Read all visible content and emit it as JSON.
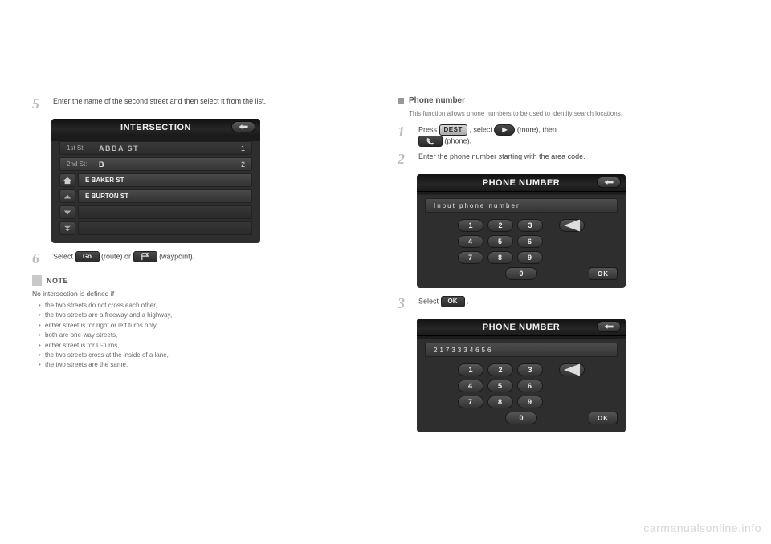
{
  "left": {
    "step5": "Enter the name of the second street and then select it from the list.",
    "shot1": {
      "title": "INTERSECTION",
      "row1_label": "1st St:",
      "row1_value": "ABBA ST",
      "row1_count": "1",
      "row2_label": "2nd St:",
      "row2_value": "B",
      "row2_count": "2",
      "items": [
        "E BAKER ST",
        "E BURTON ST",
        "",
        ""
      ]
    },
    "step6_a": "Select ",
    "step6_b": " (route) or ",
    "step6_c": " (waypoint).",
    "go_label": "Go",
    "note_title": "NOTE",
    "note_lead": "No intersection is defined if",
    "notes": [
      "the two streets do not cross each other,",
      "the two streets are a freeway and a highway,",
      "either street is for right or left turns only,",
      "both are one-way streets,",
      "either street is for U-turns,",
      "the two streets cross at the inside of a lane,",
      "the two streets are the same."
    ]
  },
  "right": {
    "section_title": "Phone number",
    "section_sub": "This function allows phone numbers to be used to identify search locations.",
    "step1_a": "Press ",
    "step1_b": " , select ",
    "step1_c": " (more), then ",
    "step1_d": " (phone).",
    "dest_label": "DEST",
    "more_glyph": "▶",
    "step2": "Enter the phone number starting with the area code.",
    "shot2": {
      "title": "PHONE NUMBER",
      "prompt": "Input phone number"
    },
    "step3_a": "Select ",
    "step3_b": ".",
    "ok_label": "OK",
    "shot3": {
      "title": "PHONE NUMBER",
      "value": "2173334656"
    },
    "keys": {
      "k1": "1",
      "k2": "2",
      "k3": "3",
      "k4": "4",
      "k5": "5",
      "k6": "6",
      "k7": "7",
      "k8": "8",
      "k9": "9",
      "k0": "0",
      "ok": "OK"
    }
  },
  "watermark": "carmanualsonline.info"
}
